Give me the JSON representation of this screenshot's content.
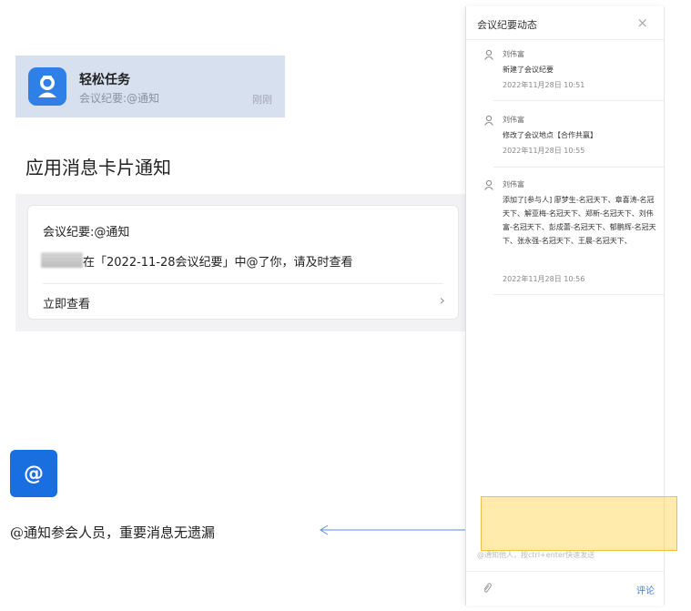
{
  "notification": {
    "title": "轻松任务",
    "subtitle": "会议纪要:@通知",
    "time": "刚刚"
  },
  "section_title": "应用消息卡片通知",
  "card": {
    "title": "会议纪要:@通知",
    "body": "在「2022-11-28会议纪要」中@了你，请及时查看",
    "action": "立即查看",
    "chevron": "›"
  },
  "at_section": {
    "icon": "@",
    "caption": "@通知参会人员，重要消息无遗漏"
  },
  "panel": {
    "title": "会议纪要动态",
    "close": "×",
    "entries": [
      {
        "user": "刘伟富",
        "text": "新建了会议纪要",
        "time": "2022年11月28日 10:51"
      },
      {
        "user": "刘伟富",
        "text": "修改了会议地点【合作共赢】",
        "time": "2022年11月28日 10:55"
      },
      {
        "user": "刘伟富",
        "text": "添加了[参与人] 廖梦生-名冠天下、章喜涛-名冠天下、解亚梅-名冠天下、郑新-名冠天下、刘伟富-名冠天下、彭成蕾-名冠天下、郁鹏辉-名冠天下、张永强-名冠天下、王晨-名冠天下、",
        "time": "2022年11月28日 10:56"
      }
    ],
    "comment_placeholder": "@通知他人，按ctrl+enter快速发送",
    "comment_button": "评论"
  },
  "colors": {
    "accent": "#1a6fe0",
    "link": "#3d7be0",
    "highlight": "#ffd23c",
    "banner_bg": "#d7e0ef"
  }
}
